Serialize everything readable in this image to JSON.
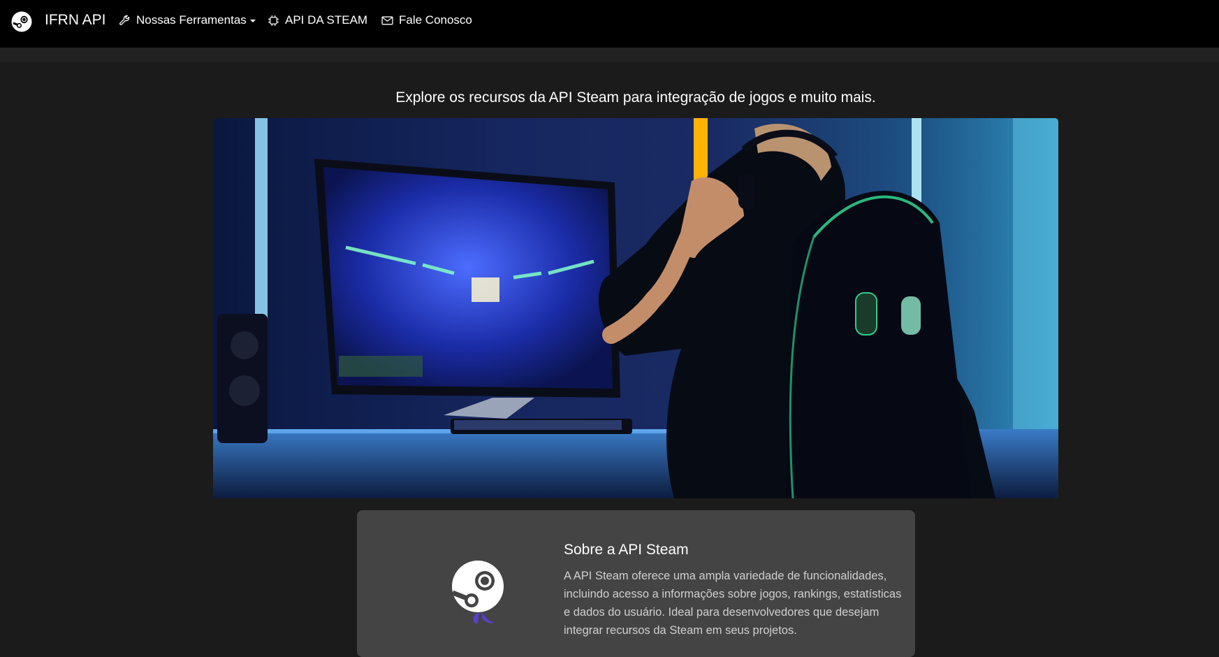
{
  "navbar": {
    "brand": "IFRN API",
    "items": [
      {
        "label": "Nossas Ferramentas",
        "icon": "wrench-icon",
        "dropdown": true
      },
      {
        "label": "API DA STEAM",
        "icon": "chip-icon"
      },
      {
        "label": "Fale Conosco",
        "icon": "envelope-icon"
      }
    ]
  },
  "hero": {
    "subtitle": "Explore os recursos da API Steam para integração de jogos e muito mais."
  },
  "about": {
    "title": "Sobre a API Steam",
    "description": "A API Steam oferece uma ampla variedade de funcionalidades, incluindo acesso a informações sobre jogos, rankings, estatísticas e dados do usuário. Ideal para desenvolvedores que desejam integrar recursos da Steam em seus projetos."
  },
  "colors": {
    "navbar_bg": "#000000",
    "page_bg": "#1b1b1b",
    "card_bg": "#444444",
    "accent_purple": "#5b3fd0"
  }
}
